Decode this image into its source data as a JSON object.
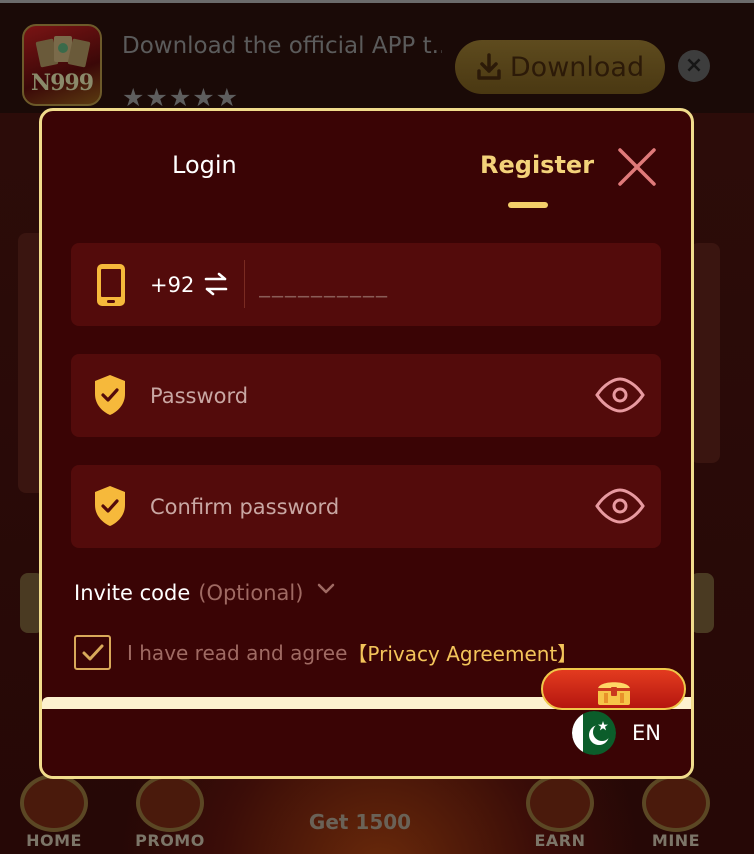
{
  "banner": {
    "title": "Download the official APP t...",
    "stars": "★★★★★",
    "download_label": "Download",
    "close_glyph": "×",
    "logo_text": "N999"
  },
  "bottom_nav": {
    "items": [
      {
        "label": "HOME"
      },
      {
        "label": "PROMO"
      },
      {
        "label": "EARN"
      },
      {
        "label": "MINE"
      }
    ],
    "get_bonus": "Get 1500"
  },
  "modal": {
    "tabs": [
      {
        "label": "Login",
        "active": false
      },
      {
        "label": "Register",
        "active": true
      }
    ],
    "phone": {
      "country_code": "+92",
      "placeholder": "__________"
    },
    "password": {
      "placeholder": "Password"
    },
    "confirm_password": {
      "placeholder": "Confirm password"
    },
    "invite": {
      "label": "Invite code",
      "optional": "(Optional)"
    },
    "agreement": {
      "checked": true,
      "text": "I have read and agree",
      "link": "【Privacy Agreement】"
    },
    "language": {
      "label": "EN",
      "flag": "pakistan-flag"
    }
  },
  "colors": {
    "modal_bg": "#3a0405",
    "field_bg": "#530b0b",
    "accent_gold": "#f3d27a",
    "border_gold": "#f1dc8c",
    "close_pink": "#e07a7a"
  }
}
